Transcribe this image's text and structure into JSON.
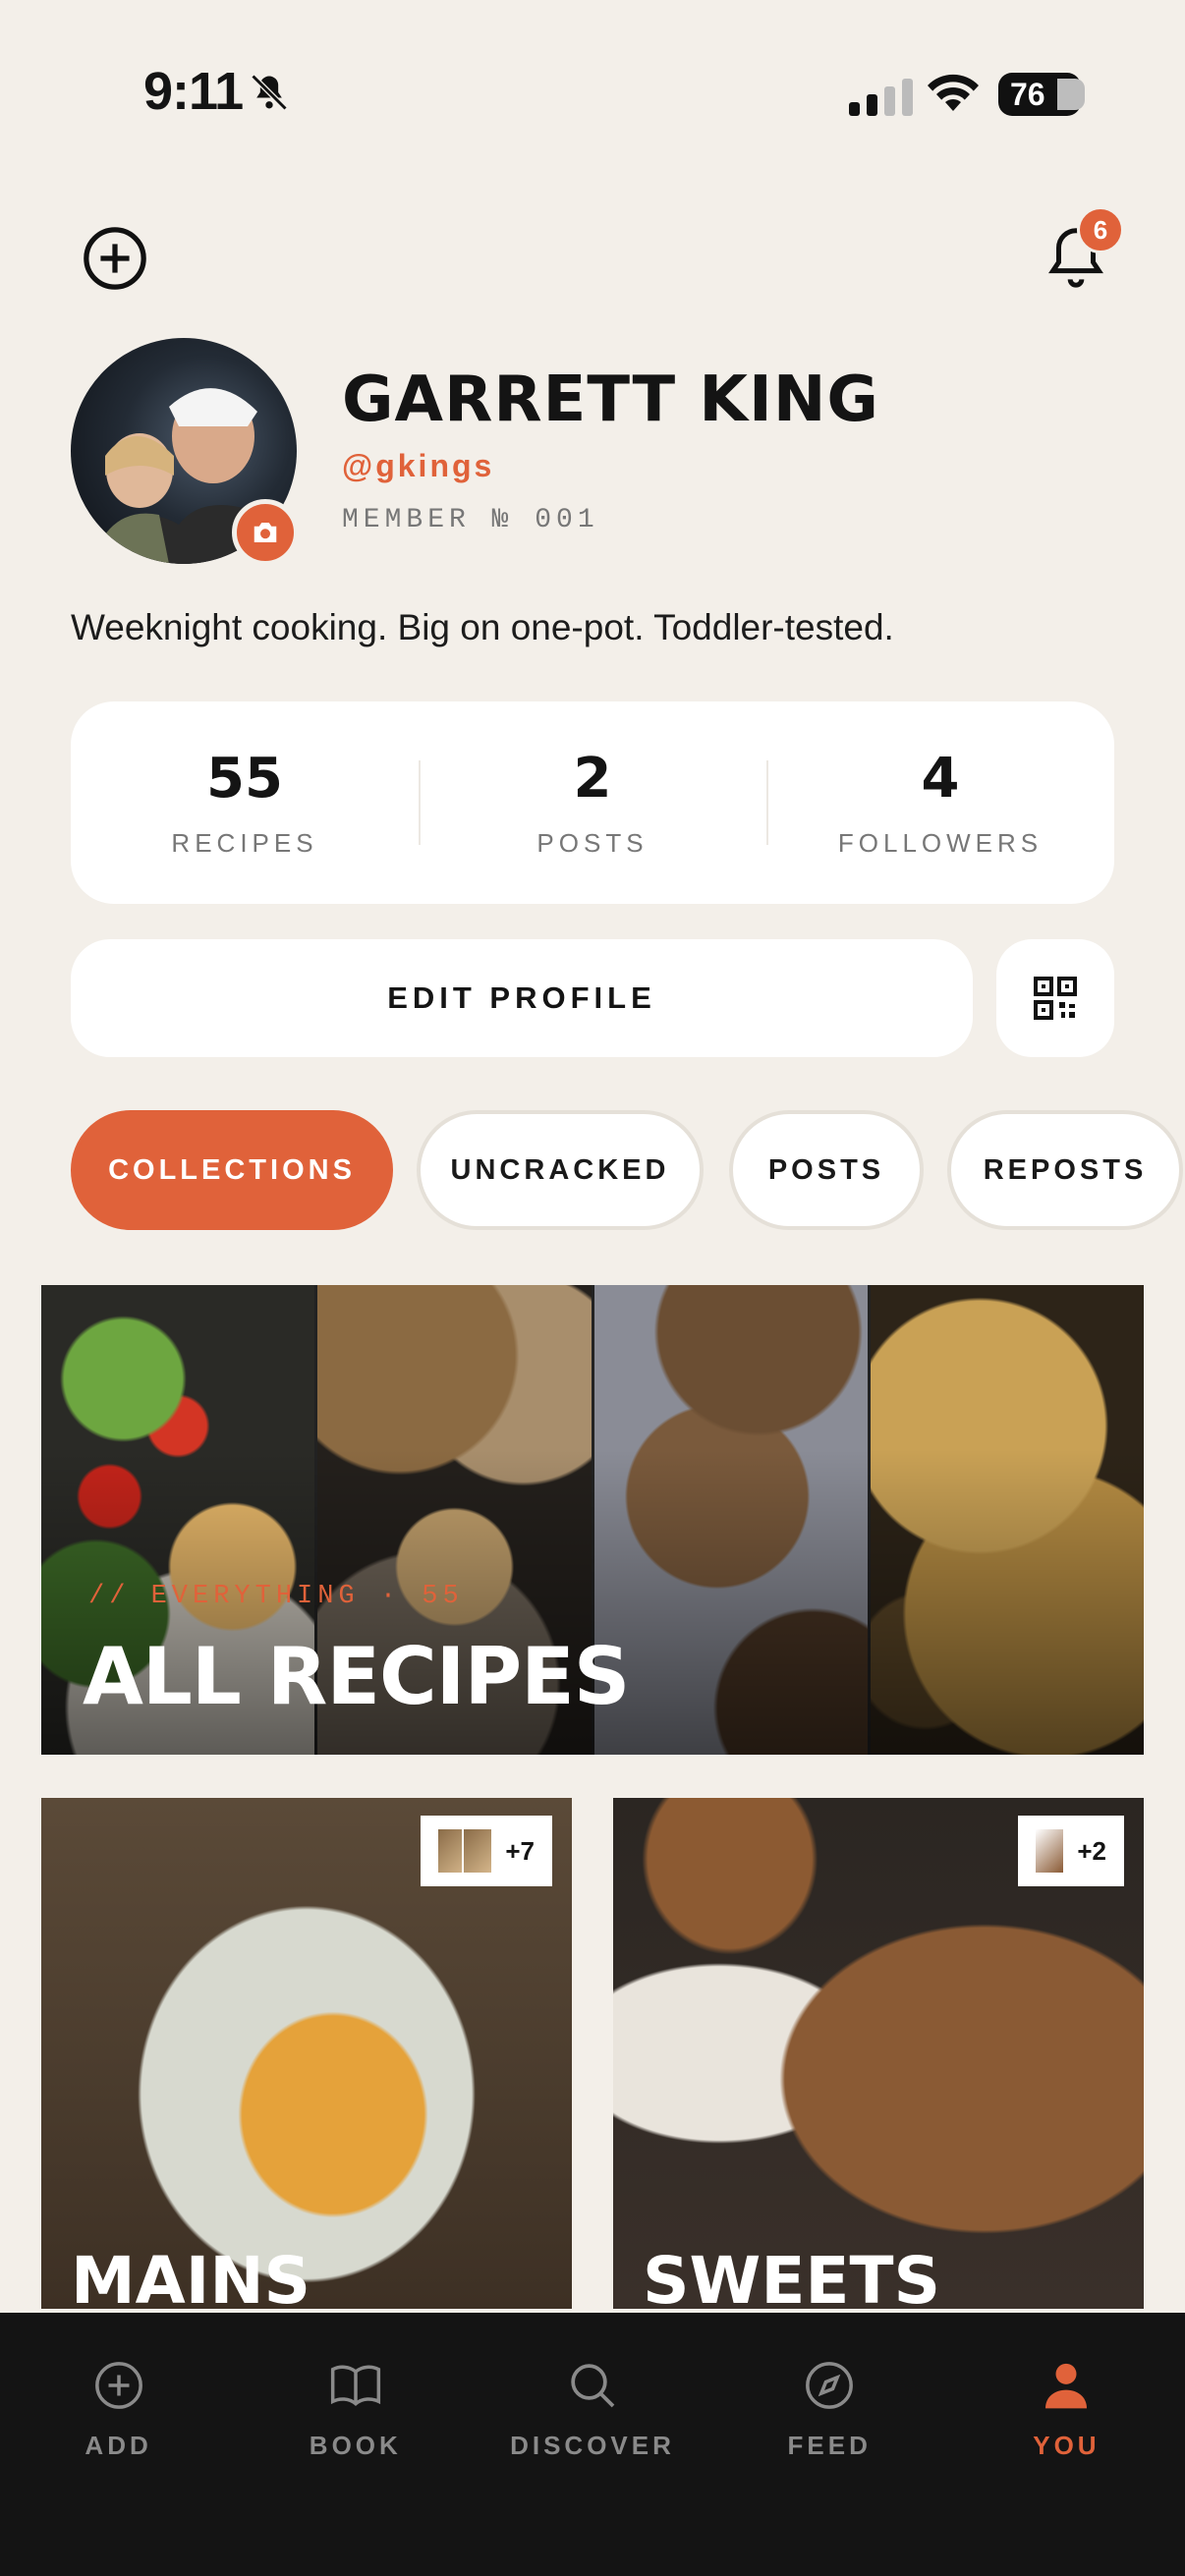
{
  "status_bar": {
    "time": "9:11",
    "battery": "76"
  },
  "header": {
    "notification_count": "6"
  },
  "profile": {
    "name": "GARRETT KING",
    "handle": "@gkings",
    "member": "MEMBER № 001",
    "bio": "Weeknight cooking. Big on one-pot. Toddler-tested."
  },
  "stats": [
    {
      "value": "55",
      "label": "RECIPES"
    },
    {
      "value": "2",
      "label": "POSTS"
    },
    {
      "value": "4",
      "label": "FOLLOWERS"
    }
  ],
  "actions": {
    "edit_profile": "EDIT PROFILE"
  },
  "tabs": [
    {
      "label": "COLLECTIONS",
      "active": true
    },
    {
      "label": "UNCRACKED",
      "active": false
    },
    {
      "label": "POSTS",
      "active": false
    },
    {
      "label": "REPOSTS",
      "active": false
    }
  ],
  "all_recipes": {
    "eyebrow": "// EVERYTHING · 55",
    "title": "ALL RECIPES"
  },
  "collections": [
    {
      "title": "MAINS",
      "extra": "+7"
    },
    {
      "title": "SWEETS",
      "extra": "+2"
    }
  ],
  "nav": [
    {
      "label": "ADD",
      "icon": "plus-circle-icon"
    },
    {
      "label": "BOOK",
      "icon": "book-icon"
    },
    {
      "label": "DISCOVER",
      "icon": "search-icon"
    },
    {
      "label": "FEED",
      "icon": "compass-icon"
    },
    {
      "label": "YOU",
      "icon": "person-icon",
      "active": true
    }
  ],
  "colors": {
    "accent": "#e0623a",
    "background": "#f3efe9",
    "nav_bg": "#141414"
  }
}
